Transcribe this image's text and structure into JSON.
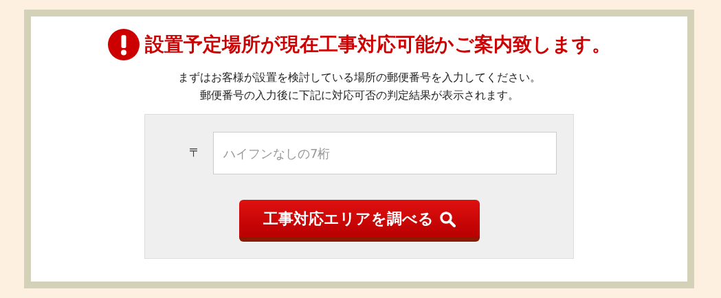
{
  "heading": "設置予定場所が現在工事対応可能かご案内致します。",
  "description": [
    "まずはお客様が設置を検討している場所の郵便番号を入力してください。",
    "郵便番号の入力後に下記に対応可否の判定結果が表示されます。"
  ],
  "postal_field": {
    "label": "〒",
    "placeholder": "ハイフンなしの7桁"
  },
  "search_button": {
    "label": "工事対応エリアを調べる"
  }
}
